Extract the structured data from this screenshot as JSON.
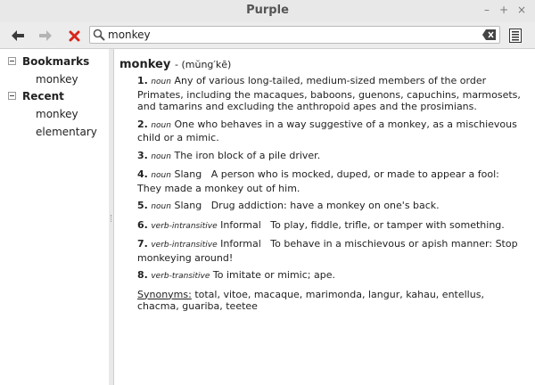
{
  "window": {
    "title": "Purple"
  },
  "window_controls": {
    "minimize": "–",
    "maximize": "+",
    "close": "×"
  },
  "toolbar": {
    "back": "arrow-left-icon",
    "forward": "arrow-right-icon",
    "stop": "stop-x-icon",
    "search_value": "monkey",
    "menu": "menu-icon"
  },
  "sidebar": {
    "bookmarks_label": "Bookmarks",
    "bookmarks": [
      "monkey"
    ],
    "recent_label": "Recent",
    "recent": [
      "monkey",
      "elementary"
    ]
  },
  "entry": {
    "headword": "monkey",
    "pronunciation": "- (mŭng′kē)",
    "definitions": [
      {
        "num": "1.",
        "pos": "noun",
        "label": "",
        "text": "Any of various long-tailed, medium-sized members of the order Primates, including the macaques, baboons, guenons, capuchins, marmosets, and tamarins and excluding the anthropoid apes and the prosimians."
      },
      {
        "num": "2.",
        "pos": "noun",
        "label": "",
        "text": "One who behaves in a way suggestive of a monkey, as a mischievous child or a mimic."
      },
      {
        "num": "3.",
        "pos": "noun",
        "label": "",
        "text": "The iron block of a pile driver."
      },
      {
        "num": "4.",
        "pos": "noun",
        "label": "Slang",
        "text": "A person who is mocked, duped, or made to appear a fool:  They made a monkey out of him."
      },
      {
        "num": "5.",
        "pos": "noun",
        "label": "Slang",
        "text": "Drug addiction:  have a monkey on one's back."
      },
      {
        "num": "6.",
        "pos": "verb-intransitive",
        "label": "Informal",
        "text": "To play, fiddle, trifle, or tamper with something."
      },
      {
        "num": "7.",
        "pos": "verb-intransitive",
        "label": "Informal",
        "text": "To behave in a mischievous or apish manner:  Stop monkeying around!"
      },
      {
        "num": "8.",
        "pos": "verb-transitive",
        "label": "",
        "text": "To imitate or mimic; ape."
      }
    ],
    "synonyms_label": "Synonyms:",
    "synonyms_text": "total, vitoe, macaque, marimonda, langur, kahau, entellus, chacma, guariba, teetee"
  }
}
